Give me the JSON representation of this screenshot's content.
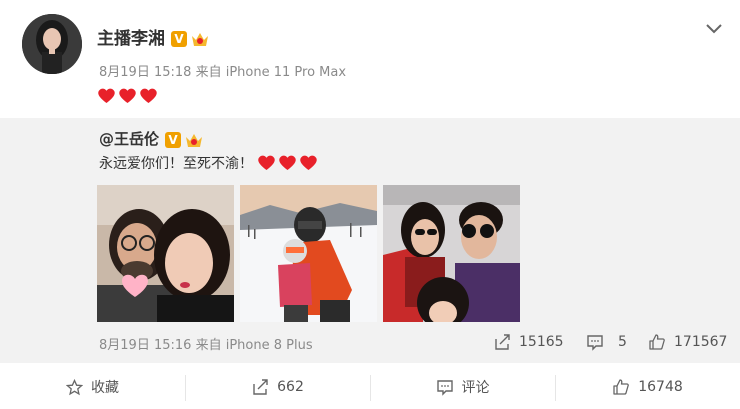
{
  "post": {
    "author": "主播李湘",
    "verified_badge": "V",
    "timestamp": "8月19日 15:18",
    "source_prefix": "来自",
    "source": "iPhone 11 Pro Max",
    "text_icons": [
      "heart-emoji",
      "heart-emoji",
      "heart-emoji"
    ]
  },
  "repost": {
    "author": "@王岳伦",
    "verified_badge": "V",
    "text": "永远爱你们！至死不渝！",
    "timestamp": "8月19日 15:16",
    "source_prefix": "来自",
    "source": "iPhone 8 Plus",
    "stats": {
      "reposts": "15165",
      "comments": "5",
      "likes": "171567"
    },
    "photos": [
      "couple-selfie-photo",
      "ski-slope-photo",
      "family-sunglasses-photo"
    ]
  },
  "actions": {
    "favorite": "收藏",
    "repost": "662",
    "comment": "评论",
    "like": "16748"
  },
  "colors": {
    "repost_bg": "#f2f2f2",
    "meta_text": "#8a8a8a",
    "badge": "#f0a000",
    "heart": "#e8212a"
  }
}
